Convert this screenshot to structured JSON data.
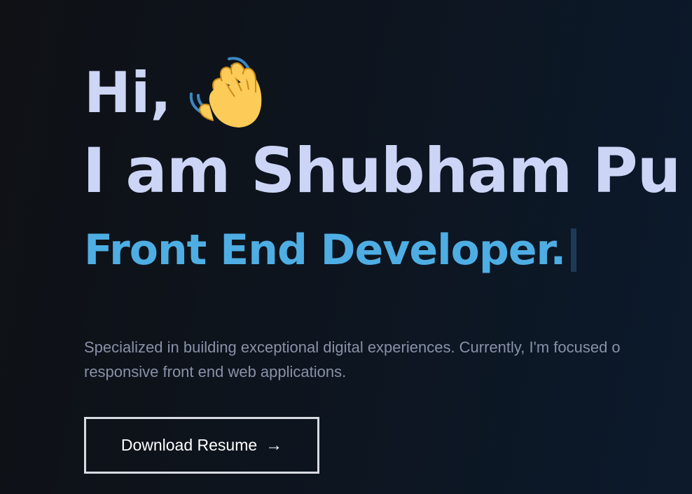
{
  "hero": {
    "greeting": "Hi,",
    "greeting_icon": "waving-hand-icon",
    "name": "I am Shubham Pu",
    "role": "Front End Developer.",
    "bio_line_1": "Specialized in building exceptional digital experiences. Currently, I'm focused o",
    "bio_line_2": "responsive front end web applications.",
    "cta_label": "Download Resume",
    "cta_icon": "→"
  },
  "colors": {
    "heading": "#ccd5f6",
    "accent": "#4eaee3",
    "body_text": "#8991a8",
    "background": "#0d1520",
    "button_border": "#d8dbe2"
  }
}
